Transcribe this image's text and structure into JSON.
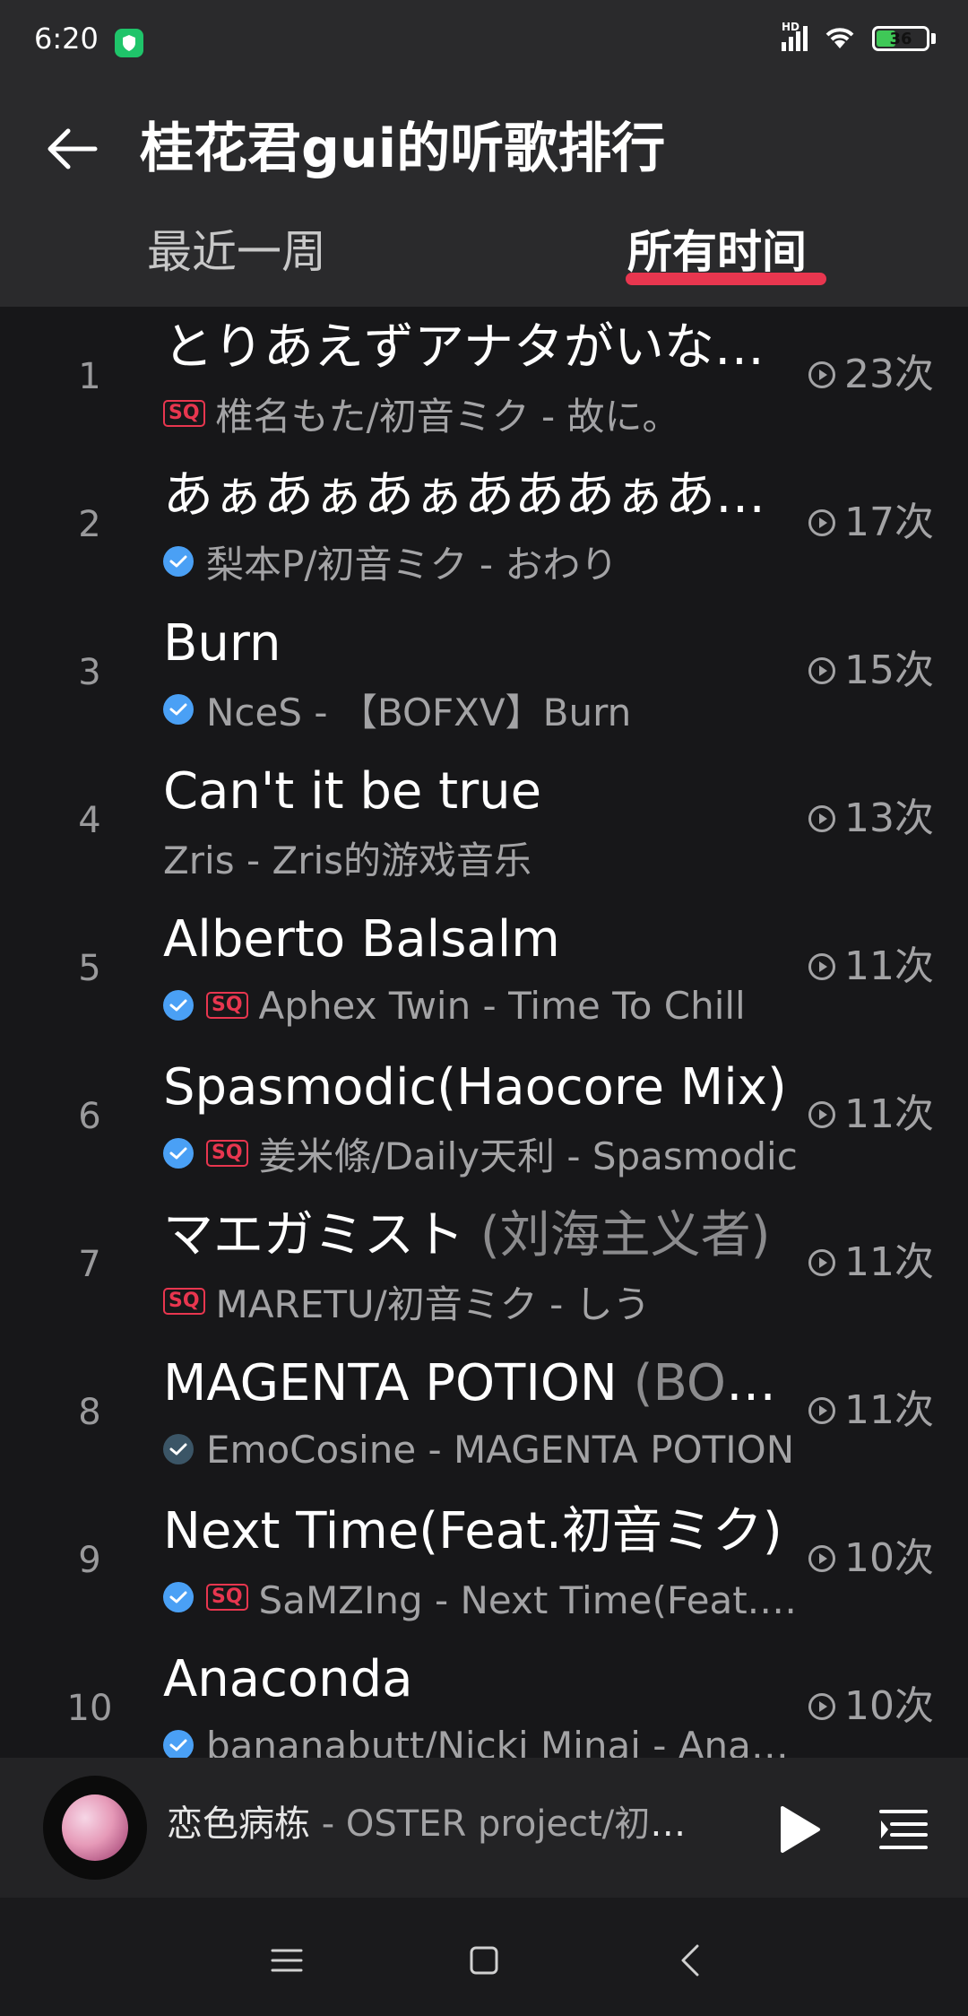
{
  "status_bar": {
    "time": "6:20",
    "network": "HD",
    "battery": "36",
    "icons": [
      "shield-icon",
      "signal-icon",
      "wifi-icon",
      "battery-icon"
    ]
  },
  "header": {
    "title": "桂花君gui的听歌排行",
    "tabs": [
      {
        "label": "最近一周",
        "selected": false
      },
      {
        "label": "所有时间",
        "selected": true
      }
    ],
    "accent_color": "#e8364f"
  },
  "songs": [
    {
      "rank": "1",
      "title": "とりあえずアナタがいなくなればそれでいい",
      "subtitle": "椎名もた/初音ミク - 故に。",
      "plays": "23次",
      "verified": false,
      "sq": true
    },
    {
      "rank": "2",
      "title": "あぁあぁあぁあああぁあぁあぁ",
      "subtitle": "梨本P/初音ミク - おわり",
      "plays": "17次",
      "verified": true,
      "sq": false
    },
    {
      "rank": "3",
      "title": "Burn",
      "subtitle": "NceS - 【BOFXV】Burn",
      "plays": "15次",
      "verified": true,
      "sq": false
    },
    {
      "rank": "4",
      "title": "Can't it be true",
      "subtitle": "Zris - Zris的游戏音乐",
      "plays": "13次",
      "verified": false,
      "sq": false
    },
    {
      "rank": "5",
      "title": "Alberto Balsalm",
      "subtitle": "Aphex Twin - Time To Chill",
      "plays": "11次",
      "verified": true,
      "sq": true
    },
    {
      "rank": "6",
      "title": "Spasmodic(Haocore Mix)",
      "subtitle": "姜米條/Daily天利 - Spasmodic",
      "plays": "11次",
      "verified": true,
      "sq": true
    },
    {
      "rank": "7",
      "title": "マエガミスト",
      "alt_title": "(刘海主义者)",
      "subtitle": "MARETU/初音ミク - しう",
      "plays": "11次",
      "verified": false,
      "sq": true
    },
    {
      "rank": "8",
      "title": "MAGENTA POTION",
      "alt_title": "(BOFXV)",
      "subtitle": "EmoCosine - MAGENTA POTION",
      "plays": "11次",
      "verified": true,
      "verified_dim": true,
      "sq": false
    },
    {
      "rank": "9",
      "title": "Next Time(Feat.初音ミク)",
      "subtitle": "SaMZIng - Next Time(Feat.初音ミク)",
      "plays": "10次",
      "verified": true,
      "sq": true
    },
    {
      "rank": "10",
      "title": "Anaconda",
      "subtitle": "bananabutt/Nicki Minaj - Anaconda",
      "plays": "10次",
      "verified": true,
      "sq": false
    }
  ],
  "player": {
    "song": "恋色病栋",
    "artist": " - OSTER project/初音ミク"
  },
  "nav": {
    "icons": [
      "menu-icon",
      "home-icon",
      "back-icon"
    ]
  }
}
